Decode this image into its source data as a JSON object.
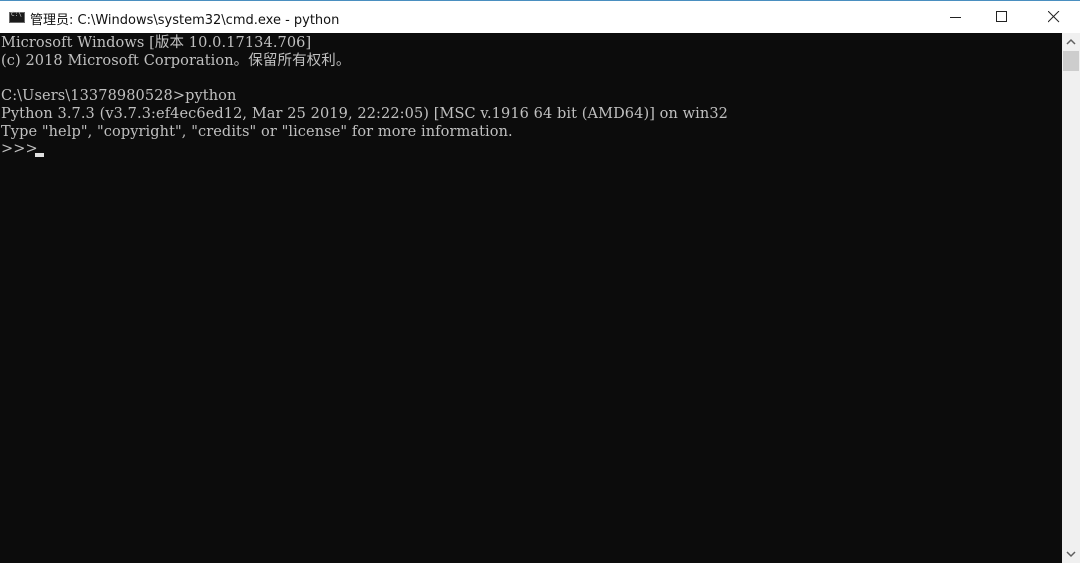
{
  "window": {
    "title": "管理员: C:\\Windows\\system32\\cmd.exe - python",
    "icon": "cmd-icon",
    "controls": {
      "minimize": "minimize-icon",
      "maximize": "maximize-icon",
      "close": "close-icon"
    }
  },
  "console": {
    "lines": [
      "Microsoft Windows [版本 10.0.17134.706]",
      "(c) 2018 Microsoft Corporation。保留所有权利。",
      "",
      "C:\\Users\\13378980528>python",
      "Python 3.7.3 (v3.7.3:ef4ec6ed12, Mar 25 2019, 22:22:05) [MSC v.1916 64 bit (AMD64)] on win32",
      "Type \"help\", \"copyright\", \"credits\" or \"license\" for more information.",
      ">>> "
    ],
    "colors": {
      "background": "#0c0c0c",
      "foreground": "#c0c0c0"
    }
  },
  "scrollbar": {
    "up": "chevron-up-icon",
    "down": "chevron-down-icon"
  }
}
